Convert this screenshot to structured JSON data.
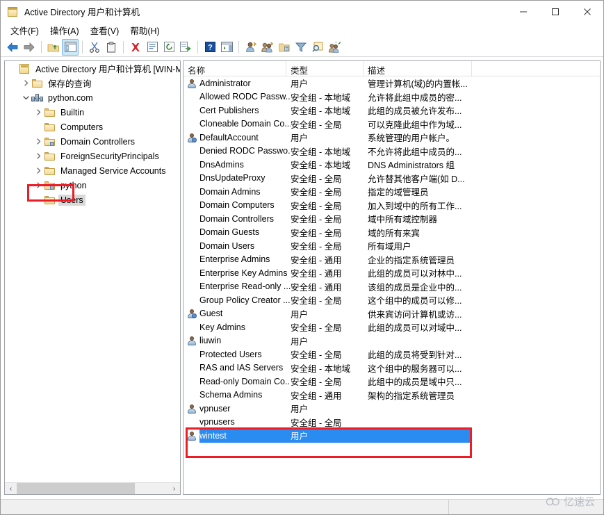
{
  "window": {
    "title": "Active Directory 用户和计算机",
    "icon": "mmc-console-icon",
    "minimize_label": "最小化",
    "maximize_label": "最大化",
    "close_label": "关闭"
  },
  "menubar": {
    "items": [
      {
        "label": "文件(F)",
        "name": "menu-file"
      },
      {
        "label": "操作(A)",
        "name": "menu-action"
      },
      {
        "label": "查看(V)",
        "name": "menu-view"
      },
      {
        "label": "帮助(H)",
        "name": "menu-help"
      }
    ]
  },
  "toolbar": {
    "buttons": [
      {
        "name": "back-icon",
        "icon": "arrow-left",
        "active": false
      },
      {
        "name": "forward-icon",
        "icon": "arrow-right",
        "active": false
      },
      {
        "name": "separator-1",
        "icon": "separator",
        "active": false
      },
      {
        "name": "up-one-level-icon",
        "icon": "folder-up",
        "active": false
      },
      {
        "name": "show-hide-console-tree-icon",
        "icon": "console-tree",
        "active": true
      },
      {
        "name": "separator-2",
        "icon": "separator",
        "active": false
      },
      {
        "name": "cut-icon",
        "icon": "scissors",
        "active": false
      },
      {
        "name": "copy-icon",
        "icon": "clipboard",
        "active": false
      },
      {
        "name": "separator-3",
        "icon": "separator",
        "active": false
      },
      {
        "name": "delete-icon",
        "icon": "red-x",
        "active": false
      },
      {
        "name": "properties-icon",
        "icon": "properties",
        "active": false
      },
      {
        "name": "refresh-icon",
        "icon": "refresh",
        "active": false
      },
      {
        "name": "export-list-icon",
        "icon": "export",
        "active": false
      },
      {
        "name": "separator-4",
        "icon": "separator",
        "active": false
      },
      {
        "name": "help-icon",
        "icon": "question-blue",
        "active": false
      },
      {
        "name": "show-hide-action-pane-icon",
        "icon": "action-pane",
        "active": false
      },
      {
        "name": "separator-5",
        "icon": "separator",
        "active": false
      },
      {
        "name": "new-user-icon",
        "icon": "new-user",
        "active": false
      },
      {
        "name": "new-group-icon",
        "icon": "new-group",
        "active": false
      },
      {
        "name": "new-ou-icon",
        "icon": "new-ou",
        "active": false
      },
      {
        "name": "filter-icon",
        "icon": "funnel",
        "active": false
      },
      {
        "name": "find-icon",
        "icon": "find",
        "active": false
      },
      {
        "name": "query-icon",
        "icon": "saved-query",
        "active": false
      }
    ]
  },
  "tree": {
    "nodes": [
      {
        "label": "Active Directory 用户和计算机 [WIN-MV",
        "indent": 0,
        "chevron": "none",
        "icon": "mmc",
        "selected": false,
        "highlighted": false
      },
      {
        "label": "保存的查询",
        "indent": 1,
        "chevron": "right",
        "icon": "folder",
        "selected": false,
        "highlighted": false
      },
      {
        "label": "python.com",
        "indent": 1,
        "chevron": "down",
        "icon": "domain",
        "selected": false,
        "highlighted": false
      },
      {
        "label": "Builtin",
        "indent": 2,
        "chevron": "right",
        "icon": "folder",
        "selected": false,
        "highlighted": false
      },
      {
        "label": "Computers",
        "indent": 2,
        "chevron": "none",
        "icon": "folder",
        "selected": false,
        "highlighted": false
      },
      {
        "label": "Domain Controllers",
        "indent": 2,
        "chevron": "right",
        "icon": "ou",
        "selected": false,
        "highlighted": false
      },
      {
        "label": "ForeignSecurityPrincipals",
        "indent": 2,
        "chevron": "right",
        "icon": "folder",
        "selected": false,
        "highlighted": false
      },
      {
        "label": "Managed Service Accounts",
        "indent": 2,
        "chevron": "right",
        "icon": "folder",
        "selected": false,
        "highlighted": false
      },
      {
        "label": "python",
        "indent": 2,
        "chevron": "right",
        "icon": "ou",
        "selected": false,
        "highlighted": false
      },
      {
        "label": "Users",
        "indent": 2,
        "chevron": "none",
        "icon": "folder",
        "selected": true,
        "highlighted": true
      }
    ],
    "scrollbar": {
      "left_arrow": "‹",
      "right_arrow": "›",
      "thumb_percent": 78
    }
  },
  "list": {
    "columns": [
      {
        "label": "名称",
        "name": "column-name"
      },
      {
        "label": "类型",
        "name": "column-type"
      },
      {
        "label": "描述",
        "name": "column-description"
      }
    ],
    "rows": [
      {
        "name": "Administrator",
        "type": "用户",
        "desc": "管理计算机(域)的内置帐...",
        "icon": "user",
        "selected": false
      },
      {
        "name": "Allowed RODC Passw...",
        "type": "安全组 - 本地域",
        "desc": "允许将此组中成员的密...",
        "icon": "group",
        "selected": false
      },
      {
        "name": "Cert Publishers",
        "type": "安全组 - 本地域",
        "desc": "此组的成员被允许发布...",
        "icon": "group",
        "selected": false
      },
      {
        "name": "Cloneable Domain Co...",
        "type": "安全组 - 全局",
        "desc": "可以克隆此组中作为域...",
        "icon": "group",
        "selected": false
      },
      {
        "name": "DefaultAccount",
        "type": "用户",
        "desc": "系统管理的用户帐户。",
        "icon": "user-special",
        "selected": false
      },
      {
        "name": "Denied RODC Passwo...",
        "type": "安全组 - 本地域",
        "desc": "不允许将此组中成员的...",
        "icon": "group",
        "selected": false
      },
      {
        "name": "DnsAdmins",
        "type": "安全组 - 本地域",
        "desc": "DNS Administrators 组",
        "icon": "group",
        "selected": false
      },
      {
        "name": "DnsUpdateProxy",
        "type": "安全组 - 全局",
        "desc": "允许替其他客户端(如 D...",
        "icon": "group",
        "selected": false
      },
      {
        "name": "Domain Admins",
        "type": "安全组 - 全局",
        "desc": "指定的域管理员",
        "icon": "group",
        "selected": false
      },
      {
        "name": "Domain Computers",
        "type": "安全组 - 全局",
        "desc": "加入到域中的所有工作...",
        "icon": "group",
        "selected": false
      },
      {
        "name": "Domain Controllers",
        "type": "安全组 - 全局",
        "desc": "域中所有域控制器",
        "icon": "group",
        "selected": false
      },
      {
        "name": "Domain Guests",
        "type": "安全组 - 全局",
        "desc": "域的所有来宾",
        "icon": "group",
        "selected": false
      },
      {
        "name": "Domain Users",
        "type": "安全组 - 全局",
        "desc": "所有域用户",
        "icon": "group",
        "selected": false
      },
      {
        "name": "Enterprise Admins",
        "type": "安全组 - 通用",
        "desc": "企业的指定系统管理员",
        "icon": "group",
        "selected": false
      },
      {
        "name": "Enterprise Key Admins",
        "type": "安全组 - 通用",
        "desc": "此组的成员可以对林中...",
        "icon": "group",
        "selected": false
      },
      {
        "name": "Enterprise Read-only ...",
        "type": "安全组 - 通用",
        "desc": "该组的成员是企业中的...",
        "icon": "group",
        "selected": false
      },
      {
        "name": "Group Policy Creator ...",
        "type": "安全组 - 全局",
        "desc": "这个组中的成员可以修...",
        "icon": "group",
        "selected": false
      },
      {
        "name": "Guest",
        "type": "用户",
        "desc": "供来宾访问计算机或访...",
        "icon": "user-special",
        "selected": false
      },
      {
        "name": "Key Admins",
        "type": "安全组 - 全局",
        "desc": "此组的成员可以对域中...",
        "icon": "group",
        "selected": false
      },
      {
        "name": "liuwin",
        "type": "用户",
        "desc": "",
        "icon": "user",
        "selected": false
      },
      {
        "name": "Protected Users",
        "type": "安全组 - 全局",
        "desc": "此组的成员将受到针对...",
        "icon": "group",
        "selected": false
      },
      {
        "name": "RAS and IAS Servers",
        "type": "安全组 - 本地域",
        "desc": "这个组中的服务器可以...",
        "icon": "group",
        "selected": false
      },
      {
        "name": "Read-only Domain Co...",
        "type": "安全组 - 全局",
        "desc": "此组中的成员是域中只...",
        "icon": "group",
        "selected": false
      },
      {
        "name": "Schema Admins",
        "type": "安全组 - 通用",
        "desc": "架构的指定系统管理员",
        "icon": "group",
        "selected": false
      },
      {
        "name": "vpnuser",
        "type": "用户",
        "desc": "",
        "icon": "user",
        "selected": false
      },
      {
        "name": "vpnusers",
        "type": "安全组 - 全局",
        "desc": "",
        "icon": "group",
        "selected": false
      },
      {
        "name": "wintest",
        "type": "用户",
        "desc": "",
        "icon": "user",
        "selected": true
      }
    ]
  },
  "statusbar": {
    "left_text": "",
    "right_text": ""
  },
  "watermark": {
    "text": "亿速云",
    "icon": "cloud-logo-icon"
  },
  "colors": {
    "highlight_box": "#ee1c25",
    "selection_blue": "#2a8bf0",
    "panel_border": "#9fa5ab",
    "toolbar_active": "#cce8f6"
  }
}
